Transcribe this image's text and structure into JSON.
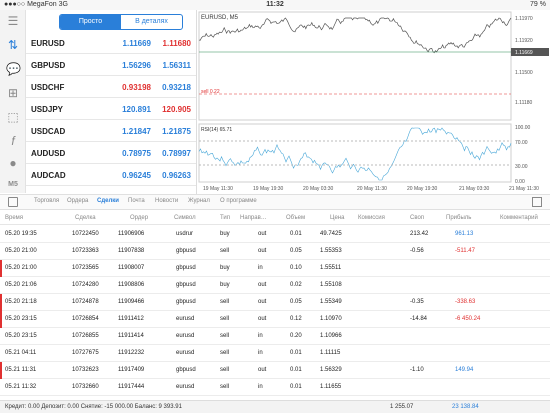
{
  "status": {
    "carrier": "●●●○○ MegaFon 3G",
    "time": "11:32",
    "battery": "79 %"
  },
  "seg": {
    "simple": "Просто",
    "detailed": "В деталях"
  },
  "quotes": [
    {
      "sym": "EURUSD",
      "bid": "1.11669",
      "ask": "1.11680",
      "bidc": "blue",
      "askc": "red"
    },
    {
      "sym": "GBPUSD",
      "bid": "1.56296",
      "ask": "1.56311",
      "bidc": "blue",
      "askc": "blue"
    },
    {
      "sym": "USDCHF",
      "bid": "0.93198",
      "ask": "0.93218",
      "bidc": "red",
      "askc": "blue"
    },
    {
      "sym": "USDJPY",
      "bid": "120.891",
      "ask": "120.905",
      "bidc": "blue",
      "askc": "red"
    },
    {
      "sym": "USDCAD",
      "bid": "1.21847",
      "ask": "1.21875",
      "bidc": "blue",
      "askc": "blue"
    },
    {
      "sym": "AUDUSD",
      "bid": "0.78975",
      "ask": "0.78997",
      "bidc": "blue",
      "askc": "blue"
    },
    {
      "sym": "AUDCAD",
      "bid": "0.96245",
      "ask": "0.96263",
      "bidc": "blue",
      "askc": "blue"
    }
  ],
  "chart": {
    "title": "EURUSD, M5",
    "sell_label": "sell 0.22",
    "rsi_label": "RSI(14) 65.71",
    "price_ticks": [
      "1.11970",
      "1.11920",
      "1.11669",
      "1.11500",
      "1.11180"
    ],
    "rsi_ticks": [
      "100.00",
      "70.00",
      "30.00",
      "0.00"
    ],
    "time_ticks": [
      "19 May 11:30",
      "19 May 19:30",
      "20 May 03:30",
      "20 May 11:30",
      "20 May 19:30",
      "21 May 03:30",
      "21 May 11:30"
    ]
  },
  "tabs": [
    "Торговля",
    "Ордера",
    "Сделки",
    "Почта",
    "Новости",
    "Журнал",
    "О программе"
  ],
  "columns": [
    "Время",
    "Сделка",
    "Ордер",
    "Символ",
    "Тип",
    "Направ…",
    "Объем",
    "Цена",
    "Комиссия",
    "Своп",
    "Прибыль",
    "Комментарий"
  ],
  "deals": [
    {
      "time": "05.20 19:35",
      "deal": "10722450",
      "order": "11906906",
      "sym": "usdrur",
      "type": "buy",
      "dir": "out",
      "vol": "0.01",
      "price": "49.7425",
      "comm": "",
      "swap": "213.42",
      "profit": "961.13",
      "pc": "blue",
      "mark": false
    },
    {
      "time": "05.20 21:00",
      "deal": "10723363",
      "order": "11907838",
      "sym": "gbpusd",
      "type": "sell",
      "dir": "out",
      "vol": "0.05",
      "price": "1.55353",
      "comm": "",
      "swap": "-0.56",
      "profit": "-511.47",
      "pc": "red",
      "mark": false
    },
    {
      "time": "05.20 21:00",
      "deal": "10723565",
      "order": "11908007",
      "sym": "gbpusd",
      "type": "buy",
      "dir": "in",
      "vol": "0.10",
      "price": "1.55511",
      "comm": "",
      "swap": "",
      "profit": "",
      "pc": "blue",
      "mark": true
    },
    {
      "time": "05.20 21:06",
      "deal": "10724280",
      "order": "11908806",
      "sym": "gbpusd",
      "type": "buy",
      "dir": "out",
      "vol": "0.02",
      "price": "1.55108",
      "comm": "",
      "swap": "",
      "profit": "",
      "pc": "blue",
      "mark": false
    },
    {
      "time": "05.20 21:18",
      "deal": "10724878",
      "order": "11909466",
      "sym": "gbpusd",
      "type": "sell",
      "dir": "out",
      "vol": "0.05",
      "price": "1.55349",
      "comm": "",
      "swap": "-0.35",
      "profit": "-338.63",
      "pc": "red",
      "mark": true
    },
    {
      "time": "05.20 23:15",
      "deal": "10726854",
      "order": "11911412",
      "sym": "eurusd",
      "type": "sell",
      "dir": "out",
      "vol": "0.12",
      "price": "1.10970",
      "comm": "",
      "swap": "-14.84",
      "profit": "-6 450.24",
      "pc": "red",
      "mark": true
    },
    {
      "time": "05.20 23:15",
      "deal": "10726855",
      "order": "11911414",
      "sym": "eurusd",
      "type": "sell",
      "dir": "in",
      "vol": "0.20",
      "price": "1.10966",
      "comm": "",
      "swap": "",
      "profit": "",
      "pc": "blue",
      "mark": false
    },
    {
      "time": "05.21 04:11",
      "deal": "10727675",
      "order": "11912232",
      "sym": "eurusd",
      "type": "sell",
      "dir": "in",
      "vol": "0.01",
      "price": "1.11115",
      "comm": "",
      "swap": "",
      "profit": "",
      "pc": "blue",
      "mark": false
    },
    {
      "time": "05.21 11:31",
      "deal": "10732623",
      "order": "11917409",
      "sym": "gbpusd",
      "type": "sell",
      "dir": "out",
      "vol": "0.01",
      "price": "1.56329",
      "comm": "",
      "swap": "-1.10",
      "profit": "149.94",
      "pc": "blue",
      "mark": true
    },
    {
      "time": "05.21 11:32",
      "deal": "10732660",
      "order": "11917444",
      "sym": "eurusd",
      "type": "sell",
      "dir": "in",
      "vol": "0.01",
      "price": "1.11655",
      "comm": "",
      "swap": "",
      "profit": "",
      "pc": "blue",
      "mark": false
    }
  ],
  "footer": {
    "summary": "Кредит: 0.00 Депозит: 0.00 Снятие: -15 000.00 Баланс: 9 393.91",
    "swap_total": "1 255.07",
    "profit_total": "23 138.84"
  }
}
